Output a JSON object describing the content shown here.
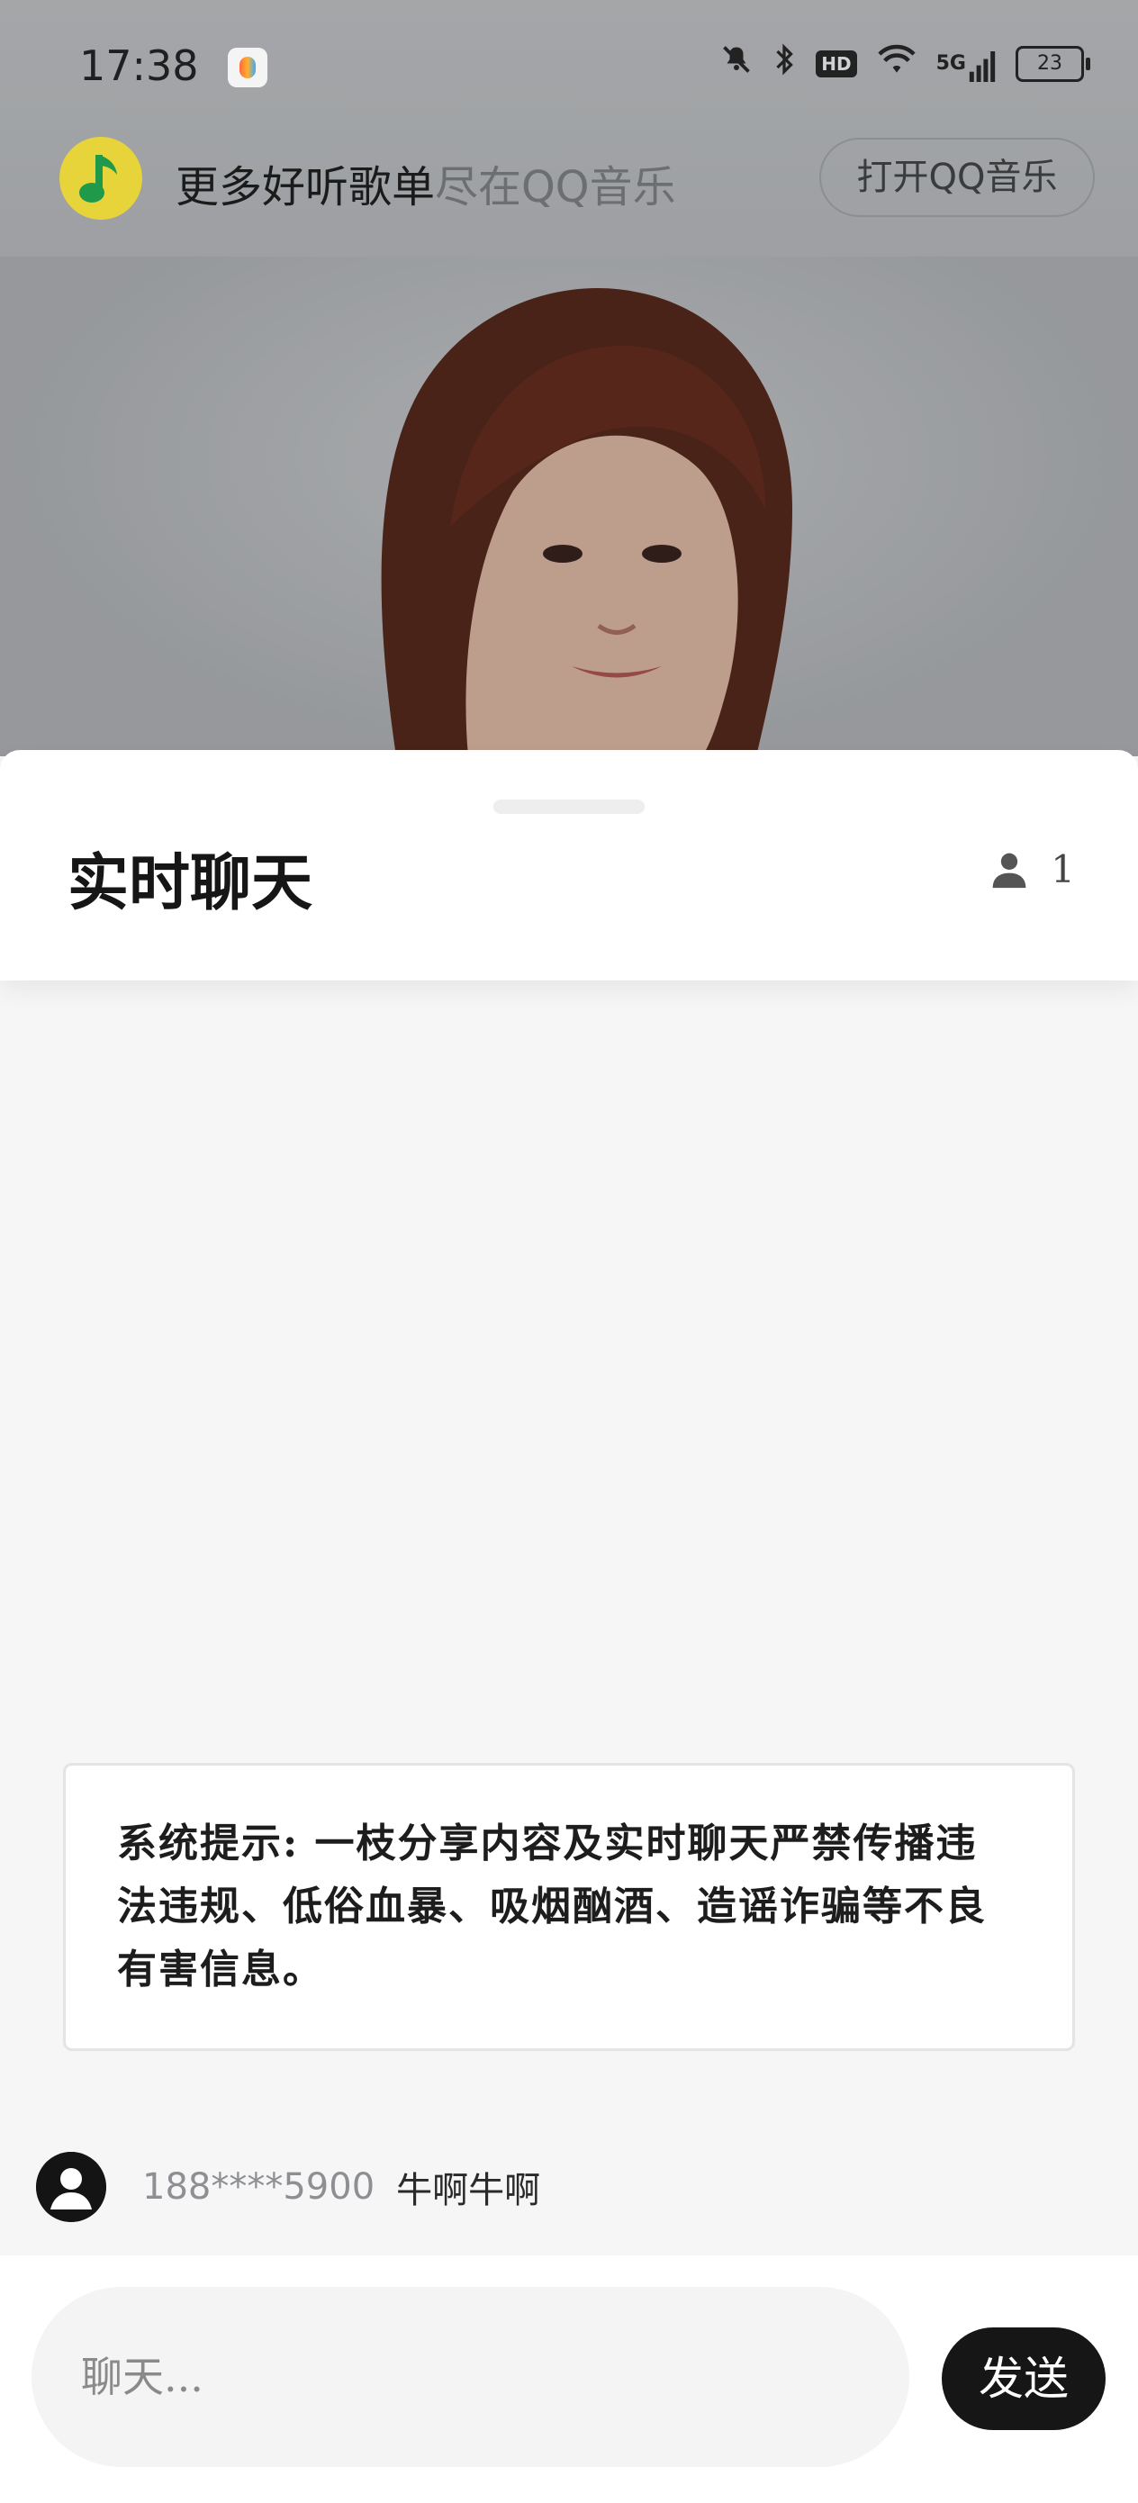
{
  "status_bar": {
    "time": "17:38",
    "network": "5G",
    "hd_label": "HD",
    "battery": "23"
  },
  "promo": {
    "title": "更多好听歌单",
    "subtitle": "尽在QQ音乐",
    "open_button": "打开QQ音乐"
  },
  "chat": {
    "title": "实时聊天",
    "online_count": "1",
    "system_notice": "系统提示: 一枝分享内容及实时聊天严禁传播违法违规、低俗血暴、吸烟酗酒、造谣诈骗等不良有害信息。",
    "messages": [
      {
        "user": "188****5900",
        "text": "牛啊牛啊"
      }
    ],
    "input_placeholder": "聊天...",
    "send_label": "发送"
  },
  "colors": {
    "qq_logo_yellow": "#e7d43a",
    "qq_logo_green": "#1f9a4a",
    "send_button": "#161616"
  }
}
